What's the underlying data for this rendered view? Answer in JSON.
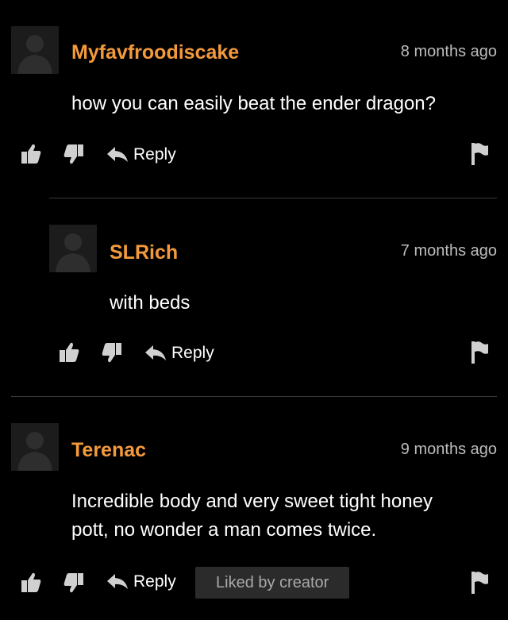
{
  "comments": [
    {
      "username": "Myfavfroodiscake",
      "time": "8 months ago",
      "text": "how you can easily beat the ender dragon?",
      "reply_label": "Reply"
    },
    {
      "username": "SLRich",
      "time": "7 months ago",
      "text": "with beds",
      "reply_label": "Reply"
    },
    {
      "username": "Terenac",
      "time": "9 months ago",
      "text": "Incredible body and very sweet tight honey pott, no wonder a man comes twice.",
      "reply_label": "Reply",
      "badge": "Liked by creator"
    }
  ],
  "colors": {
    "background": "#000000",
    "username": "#f49a3d",
    "timestamp": "#bdbdbd",
    "icon": "#d0d0d0",
    "badge_bg": "#2b2b2b"
  },
  "icons": [
    "avatar-placeholder",
    "thumbs-up-icon",
    "thumbs-down-icon",
    "reply-arrow-icon",
    "flag-icon"
  ]
}
